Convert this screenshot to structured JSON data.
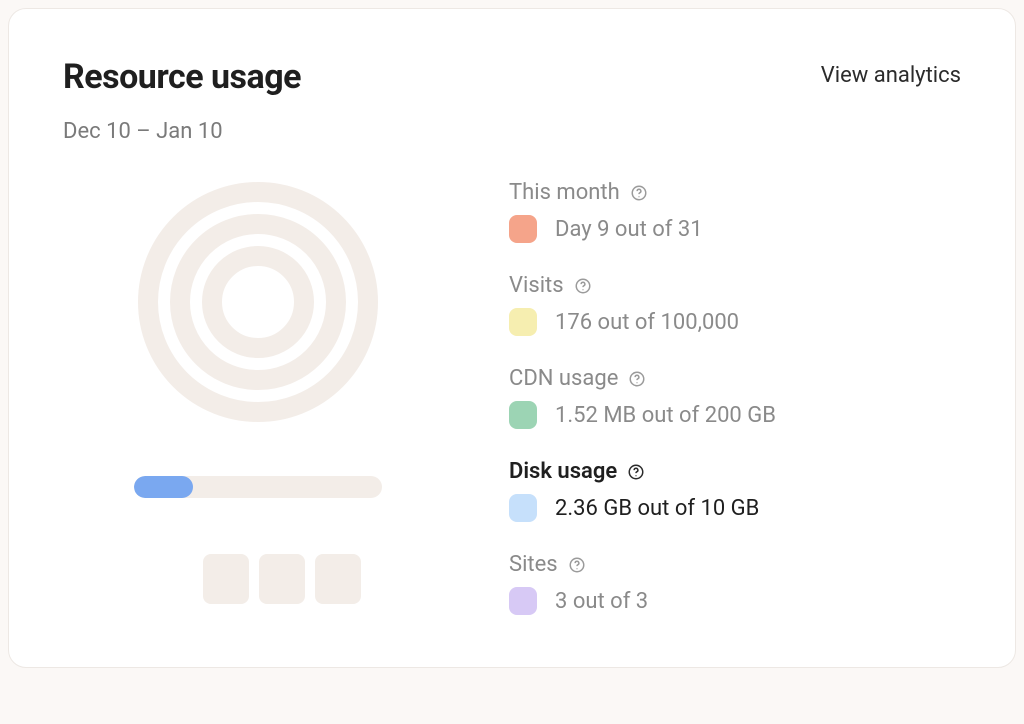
{
  "header": {
    "title": "Resource usage",
    "view_analytics_label": "View analytics",
    "date_range": "Dec 10 – Jan 10"
  },
  "metrics": [
    {
      "title": "This month",
      "value": "Day 9 out of 31",
      "swatch": "#f5a48a",
      "active": false
    },
    {
      "title": "Visits",
      "value": "176 out of 100,000",
      "swatch": "#f6eeb0",
      "active": false
    },
    {
      "title": "CDN usage",
      "value": "1.52 MB out of 200 GB",
      "swatch": "#9cd4b4",
      "active": false
    },
    {
      "title": "Disk usage",
      "value": "2.36 GB out of 10 GB",
      "swatch": "#c6e0fb",
      "active": true
    },
    {
      "title": "Sites",
      "value": "3 out of 3",
      "swatch": "#d7c9f5",
      "active": false
    }
  ],
  "disk_bar_fill_pct": 23.6
}
